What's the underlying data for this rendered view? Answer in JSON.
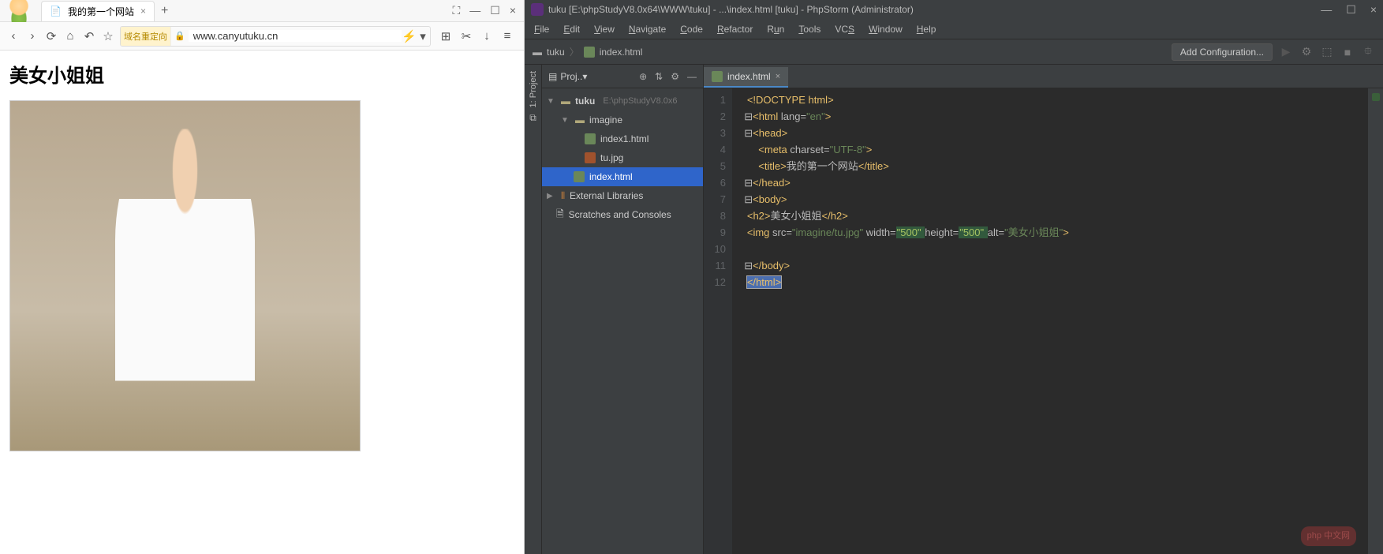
{
  "browser": {
    "tab": {
      "title": "我的第一个网站",
      "close": "×"
    },
    "newtab": "+",
    "win": {
      "portal": "⛶",
      "min": "—",
      "max": "☐",
      "close": "×"
    },
    "nav": {
      "back": "‹",
      "fwd": "›",
      "reload": "⟳",
      "home": "⌂",
      "undo": "↶",
      "star": "☆",
      "tag": "域名重定向",
      "lock": "🔒",
      "url": "www.canyutuku.cn",
      "bolt": "⚡",
      "more": "▾",
      "grid": "⊞",
      "cut": "✂",
      "dl": "↓",
      "menu": "≡"
    },
    "page": {
      "heading": "美女小姐姐"
    }
  },
  "ide": {
    "title": "tuku [E:\\phpStudyV8.0x64\\WWW\\tuku] - ...\\index.html [tuku] - PhpStorm (Administrator)",
    "win": {
      "min": "—",
      "max": "☐",
      "close": "×"
    },
    "menu": {
      "file": "File",
      "edit": "Edit",
      "view": "View",
      "navigate": "Navigate",
      "code": "Code",
      "refactor": "Refactor",
      "run": "Run",
      "tools": "Tools",
      "vcs": "VCS",
      "window": "Window",
      "help": "Help"
    },
    "crumb": {
      "root": "tuku",
      "file": "index.html",
      "sep": "〉"
    },
    "addconf": "Add Configuration...",
    "toolbar_icons": {
      "play": "▶",
      "bug": "⚙",
      "cov": "⬚",
      "stop": "■"
    },
    "left_tool": {
      "project_v": "1: Project",
      "structure": "⧉"
    },
    "tree": {
      "header": "Proj..▾",
      "target": "⊕",
      "collapse": "⇅",
      "gear": "⚙",
      "hide": "—",
      "root": "tuku",
      "root_path": "E:\\phpStudyV8.0x6",
      "imagine": "imagine",
      "index1": "index1.html",
      "tu": "tu.jpg",
      "index": "index.html",
      "ext": "External Libraries",
      "scratch": "Scratches and Consoles"
    },
    "editor": {
      "tab": "index.html",
      "tab_close": "×",
      "lines": [
        "1",
        "2",
        "3",
        "4",
        "5",
        "6",
        "7",
        "8",
        "9",
        "10",
        "11",
        "12"
      ],
      "code": {
        "l1a": "<!DOCTYPE ",
        "l1b": "html",
        "l1c": ">",
        "l2a": "<",
        "l2b": "html ",
        "l2c": "lang=",
        "l2d": "\"en\"",
        "l2e": ">",
        "l3a": "<",
        "l3b": "head",
        "l3c": ">",
        "l4a": "<",
        "l4b": "meta ",
        "l4c": "charset=",
        "l4d": "\"UTF-8\"",
        "l4e": ">",
        "l5a": "<",
        "l5b": "title",
        "l5c": ">",
        "l5d": "我的第一个网站",
        "l5e": "</",
        "l5f": "title",
        "l5g": ">",
        "l6a": "</",
        "l6b": "head",
        "l6c": ">",
        "l7a": "<",
        "l7b": "body",
        "l7c": ">",
        "l8a": "<",
        "l8b": "h2",
        "l8c": ">",
        "l8d": "美女小姐姐",
        "l8e": "</",
        "l8f": "h2",
        "l8g": ">",
        "l9a": "<",
        "l9b": "img ",
        "l9c": "src=",
        "l9d": "\"imagine/tu.jpg\" ",
        "l9e": "width=",
        "l9f": "\"500\" ",
        "l9g": "height=",
        "l9h": "\"500\" ",
        "l9i": "alt=",
        "l9j": "\"美女小姐姐\"",
        "l9k": ">",
        "l11a": "</",
        "l11b": "body",
        "l11c": ">",
        "l12a": "</",
        "l12b": "html",
        "l12c": ">"
      }
    },
    "watermark": "php 中文网"
  }
}
